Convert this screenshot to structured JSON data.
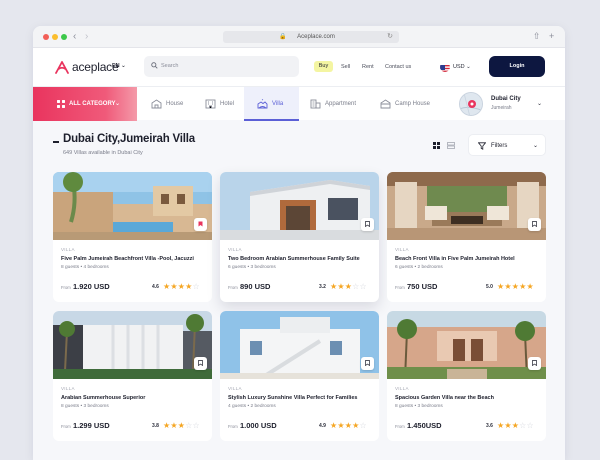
{
  "browser": {
    "url": "Aceplace.com"
  },
  "header": {
    "brand": "aceplace",
    "lang": "EN",
    "search_placeholder": "Search",
    "links": [
      "Buy",
      "Sell",
      "Rent",
      "Contact us"
    ],
    "currency": "USD",
    "login_label": "Login"
  },
  "categories": {
    "all_label": "ALL CATEGORY",
    "items": [
      "House",
      "Hotel",
      "Villa",
      "Appartment",
      "Camp House"
    ],
    "active": "Villa"
  },
  "location": {
    "city": "Dubai City",
    "area": "Jumeirah"
  },
  "page": {
    "title": "Dubai City,Jumeirah Villa",
    "subtitle": "649 Villas available in Dubai City",
    "filters_label": "Filters"
  },
  "card_common": {
    "type": "VILLA",
    "from_label": "From"
  },
  "listings": [
    {
      "name": "Five Palm Jumeirah Beachfront Villa -Pool, Jacuzzi",
      "info": "8 guests • 4 bedrooms",
      "price": "1.920 USD",
      "rating": "4.6",
      "stars": 4,
      "bookmarked": true
    },
    {
      "name": "Two Bedroom Arabian Summerhouse Family Suite",
      "info": "6 guests • 3 bedrooms",
      "price": "890 USD",
      "rating": "3.2",
      "stars": 3,
      "bookmarked": false
    },
    {
      "name": "Beach Front Villa in Five Palm Jumeirah Hotel",
      "info": "6 guests • 2 bedrooms",
      "price": "750 USD",
      "rating": "5.0",
      "stars": 5,
      "bookmarked": false
    },
    {
      "name": "Arabian Summerhouse Superior",
      "info": "8 guests • 3 bedrooms",
      "price": "1.299 USD",
      "rating": "3.8",
      "stars": 3,
      "bookmarked": false
    },
    {
      "name": "Stylish Luxury Sunshine Villa Perfect for Families",
      "info": "4 guests • 2 bedrooms",
      "price": "1.000 USD",
      "rating": "4.9",
      "stars": 4,
      "bookmarked": false
    },
    {
      "name": "Spacious Garden Villa near the Beach",
      "info": "8 guests • 3 bedrooms",
      "price": "1.450USD",
      "rating": "3.6",
      "stars": 3,
      "bookmarked": false
    }
  ],
  "colors": {
    "accent": "#e9345e",
    "primary": "#0d1740",
    "active_tab": "#5b5fd6",
    "star": "#f5a623"
  }
}
